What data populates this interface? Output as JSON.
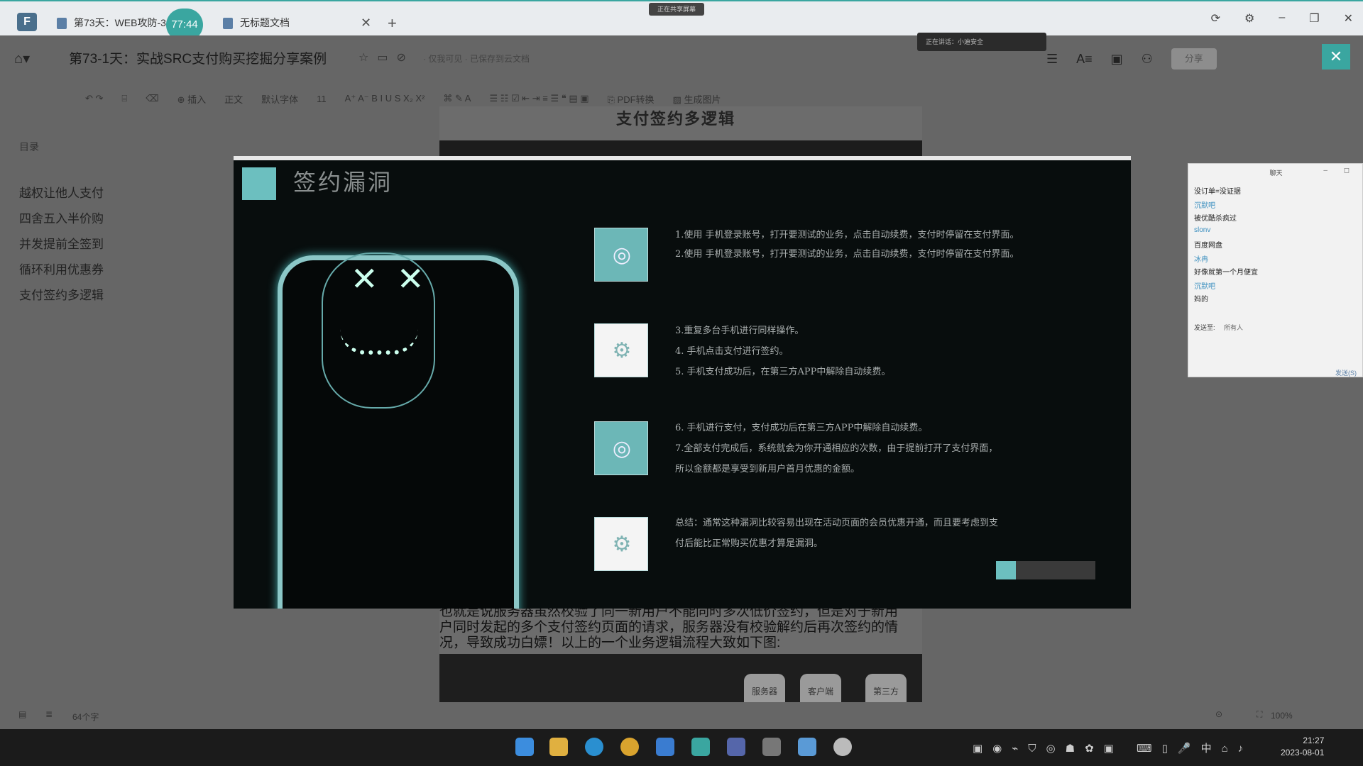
{
  "tabs": [
    {
      "label": "第73天：WEB攻防-3"
    },
    {
      "label": "无标题文档"
    }
  ],
  "timer_badge": "77:44",
  "share_indicator": "正在共享屏幕",
  "doc": {
    "title": "第73-1天：实战SRC支付购买挖掘分享案例",
    "meta": "· 仅我可见 · 已保存到云文档",
    "heading": "支付签约多逻辑"
  },
  "speaking_indicator": "正在讲话：小迪安全",
  "header_buttons": {
    "share": "分享"
  },
  "toolbar": {
    "insert": "插入",
    "style": "正文",
    "font": "默认字体",
    "size": "11",
    "pdf": "PDF转换",
    "image": "生成图片"
  },
  "outline": {
    "title": "目录",
    "items": [
      "越权让他人支付",
      "四舍五入半价购",
      "并发提前全签到",
      "循环利用优惠券",
      "支付签约多逻辑"
    ]
  },
  "slide": {
    "title": "签约漏洞",
    "lines": [
      "1.使用 手机登录账号，打开要测试的业务，点击自动续费，支付时停留在支付界面。",
      "2.使用 手机登录账号，打开要测试的业务，点击自动续费，支付时停留在支付界面。",
      "3.重复多台手机进行同样操作。",
      "4. 手机点击支付进行签约。",
      "5. 手机支付成功后，在第三方APP中解除自动续费。",
      "6. 手机进行支付，支付成功后在第三方APP中解除自动续费。",
      "7.全部支付完成后，系统就会为你开通相应的次数，由于提前打开了支付界面，",
      "所以金额都是享受到新用户首月优惠的金额。",
      "总结：通常这种漏洞比较容易出现在活动页面的会员优惠开通，而且要考虑到支",
      "付后能比正常购买优惠才算是漏洞。"
    ]
  },
  "doc_body": {
    "paragraph_1": "也就是说服务器虽然校验了同一新用户不能同时多次低价签约，但是对于新用",
    "paragraph_2": "户同时发起的多个支付签约页面的请求，服务器没有校验解约后再次签约的情",
    "paragraph_3": "况，导致成功白嫖！以上的一个业务逻辑流程大致如下图:",
    "flow_tabs": [
      "服务器",
      "客户端",
      "第三方"
    ]
  },
  "chat": {
    "header": "聊天",
    "messages": [
      {
        "type": "text",
        "text": "没订单=没证据"
      },
      {
        "type": "name",
        "text": "沉默吧"
      },
      {
        "type": "text",
        "text": "被优酷杀疯过"
      },
      {
        "type": "name",
        "text": "slonv"
      },
      {
        "type": "text",
        "text": "百度网盘"
      },
      {
        "type": "name",
        "text": "冰冉"
      },
      {
        "type": "text",
        "text": "好像就第一个月便宜"
      },
      {
        "type": "name",
        "text": "沉默吧"
      },
      {
        "type": "text",
        "text": "妈的"
      }
    ],
    "send_to_label": "发送至:",
    "send_to_target": "所有人",
    "send_button": "发送(S)"
  },
  "status_bar": {
    "word_count": "64个字",
    "zoom": "100%"
  },
  "clock": {
    "time": "21:27",
    "date": "2023-08-01"
  },
  "colors": {
    "accent": "#3aa6a0",
    "slide_bg": "#080d0d",
    "slide_card": "#6cb7b7"
  }
}
